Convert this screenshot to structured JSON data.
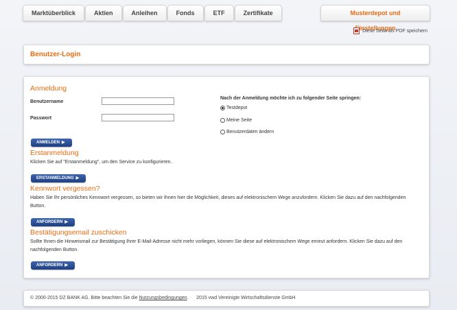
{
  "nav": {
    "tabs": [
      {
        "label": "Marktüberblick"
      },
      {
        "label": "Aktien"
      },
      {
        "label": "Anleihen"
      },
      {
        "label": "Fonds"
      },
      {
        "label": "ETF"
      },
      {
        "label": "Zertifikate"
      }
    ],
    "primary_tab": "Musterdepot und Einstellungen"
  },
  "pdf_link": "Diese Seite als PDF speichern",
  "header": {
    "title": "Benutzer-Login"
  },
  "login": {
    "title": "Anmeldung",
    "username_label": "Benutzername",
    "password_label": "Passwort",
    "submit_label": "ANMELDEN"
  },
  "redirect": {
    "title": "Nach der Anmeldung möchte ich zu folgender Seite springen:",
    "options": [
      {
        "label": "Testdepot",
        "checked": true
      },
      {
        "label": "Meine Seite",
        "checked": false
      },
      {
        "label": "Benutzerdaten ändern",
        "checked": false
      }
    ]
  },
  "register": {
    "title": "Erstanmeldung",
    "text": "Klicken Sie auf \"Erstanmeldung\", um den Service zu konfigurieren.",
    "button": "ERSTANMELDUNG"
  },
  "forgot": {
    "title": "Kennwort vergessen?",
    "text": "Haben Sie Ihr persönliches Kennwort vergessen, so bieten wir Ihnen hier die Möglichkeit, dieses auf elektronischem Wege anzufordern. Klicken Sie dazu auf den nachfolgenden Button.",
    "button": "ANFORDERN"
  },
  "confirm": {
    "title": "Bestätigungsemail zuschicken",
    "text": "Sollte Ihnen die Hinweismail zur Bestätigung Ihrer E-Mail-Adresse nicht mehr vorliegen, können Sie diese auf elektronischem Wege erneut anfordern. Klicken Sie dazu auf den nachfolgenden Button.",
    "button": "ANFORDERN"
  },
  "footer": {
    "prefix": "© 2000-2015 DZ BANK AG. Bitte beachten Sie die",
    "link": "Nutzungsbedingungen",
    "suffix": ".      2015 vwd Vereinigte Wirtschaftsdienste GmbH"
  },
  "colors": {
    "accent": "#e96b12",
    "button": "#2a4c94"
  }
}
